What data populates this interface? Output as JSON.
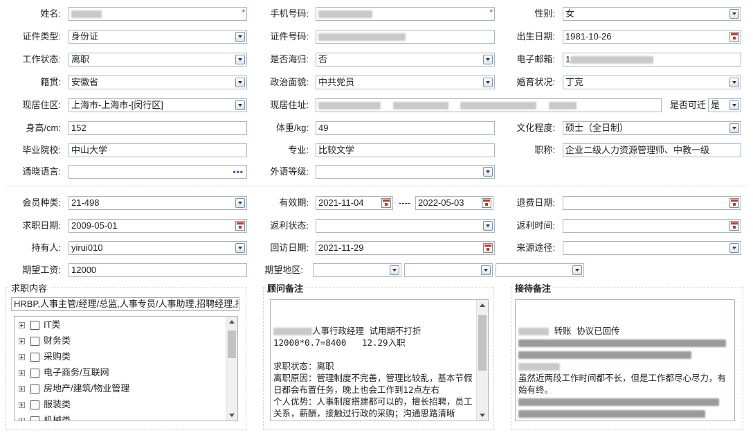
{
  "labels": {
    "name": "姓名:",
    "phone": "手机号码:",
    "gender": "性别:",
    "id_type": "证件类型:",
    "id_number": "证件号码:",
    "birth_date": "出生日期:",
    "work_status": "工作状态:",
    "returnee": "是否海归:",
    "email": "电子邮箱:",
    "origin": "籍贯:",
    "politics": "政治面貌:",
    "marital": "婚育状况:",
    "residence_area": "现居住区:",
    "address": "现居住址:",
    "relocatable": "是否可迁",
    "height": "身高/cm:",
    "weight": "体重/kg:",
    "education": "文化程度:",
    "school": "毕业院校:",
    "major": "专业:",
    "title": "职称:",
    "language": "通晓语言:",
    "foreign_level": "外语等级:",
    "member_type": "会员种类:",
    "valid_period": "有效期:",
    "refund_date": "退费日期:",
    "job_date": "求职日期:",
    "rebate_status": "返利状态:",
    "rebate_time": "返利时间:",
    "holder": "持有人:",
    "revisit_date": "回访日期:",
    "source": "来源途径:",
    "salary": "期望工资:",
    "region": "期望地区:"
  },
  "values": {
    "gender": "女",
    "id_type": "身份证",
    "birth_date": "1981-10-26",
    "work_status": "离职",
    "returnee": "否",
    "email_prefix": "1",
    "origin": "安徽省",
    "politics": "中共党员",
    "marital": "丁克",
    "residence_area": "上海市-上海市-[闵行区]",
    "relocatable": "是",
    "height": "152",
    "weight": "49",
    "education": "硕士（全日制）",
    "school": "中山大学",
    "major": "比较文学",
    "title": "企业二级人力资源管理师、中教一级",
    "member_type": "21-498",
    "valid_from": "2021-11-04",
    "valid_sep": "----",
    "valid_to": "2022-05-03",
    "job_date": "2009-05-01",
    "holder": "yirui010",
    "revisit_date": "2021-11-29",
    "salary": "12000"
  },
  "required_mark": "*",
  "dots": "•••",
  "job_content": {
    "title": "求职内容",
    "summary": "HRBP,人事主管/经理/总监,人事专员/人事助理,招聘经理,招",
    "tree": [
      "IT类",
      "财务类",
      "采购类",
      "电子商务/互联网",
      "房地产/建筑/物业管理",
      "服装类",
      "机械类"
    ]
  },
  "advisor_notes": {
    "title": "顾问备注",
    "line1_visible": "人事行政经理 试用期不打折",
    "text": "12000*0.7=8400   12.29入职\n\n求职状态：离职\n离职原因：管理制度不完善，管理比较乱，基本节假日都会布置任务，晚上也会工作到12点左右\n个人优势：人事制度搭建都可以的，擅长招聘，员工关系，薪酬，接触过行政的采购；沟通思路清晰\n推荐范围：人事主管/经理；HRBP；招聘经理/主管"
  },
  "reception_notes": {
    "title": "接待备注",
    "line1_visible": "转账 协议已回传",
    "line_visible": "虽然近两段工作时间都不长，但是工作都尽心尽力，有始有终。"
  }
}
